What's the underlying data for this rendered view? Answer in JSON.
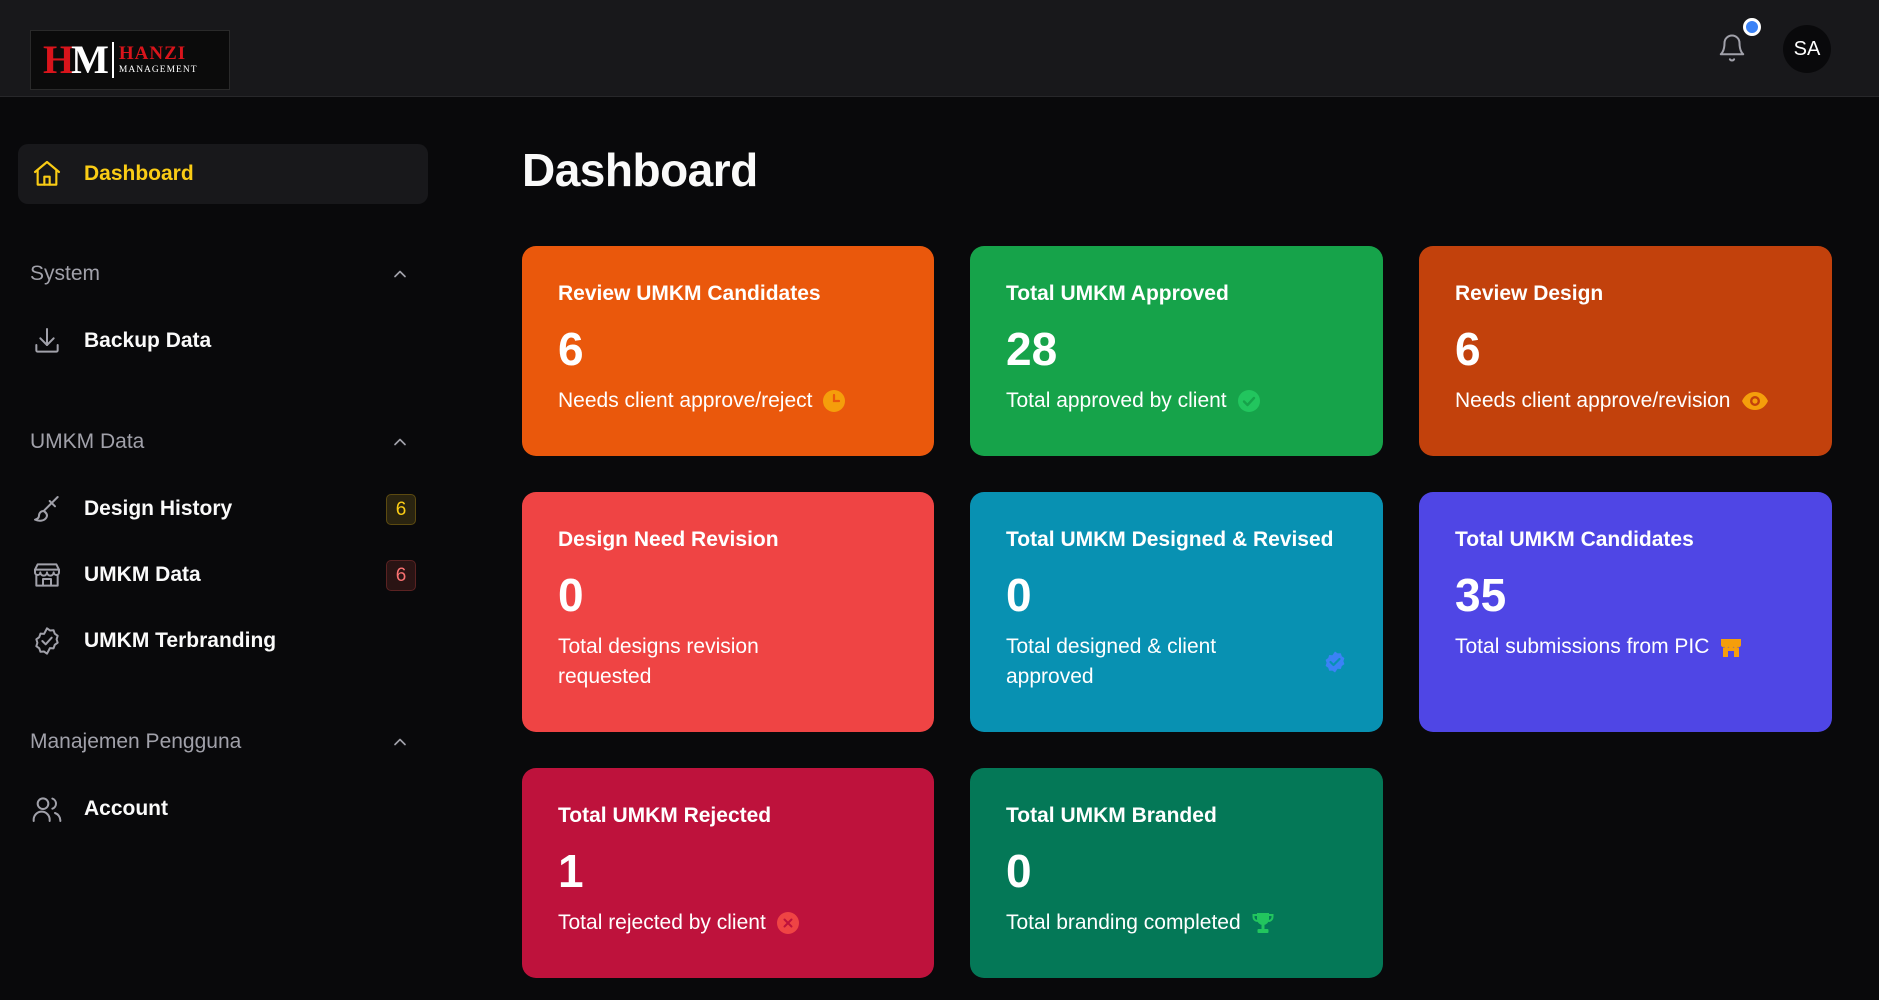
{
  "header": {
    "logo": {
      "mark_h": "H",
      "mark_m": "M",
      "brand": "HANZI",
      "sub": "MANAGEMENT"
    },
    "notification_icon": "bell-icon",
    "avatar_initials": "SA",
    "notification_dot_color": "#3b82f6"
  },
  "sidebar": {
    "active": {
      "label": "Dashboard",
      "icon": "home-icon"
    },
    "sections": [
      {
        "title": "System",
        "items": [
          {
            "label": "Backup Data",
            "icon": "download-icon"
          }
        ]
      },
      {
        "title": "UMKM Data",
        "items": [
          {
            "label": "Design History",
            "icon": "brush-icon",
            "badge": "6"
          },
          {
            "label": "UMKM Data",
            "icon": "store-icon",
            "badge": "6"
          },
          {
            "label": "UMKM Terbranding",
            "icon": "badge-check-icon"
          }
        ]
      },
      {
        "title": "Manajemen Pengguna",
        "items": [
          {
            "label": "Account",
            "icon": "users-icon"
          }
        ]
      }
    ]
  },
  "main": {
    "title": "Dashboard",
    "cards": [
      {
        "title": "Review UMKM Candidates",
        "value": "6",
        "desc": "Needs client approve/reject",
        "color": "#ea580c",
        "icon": "clock-icon"
      },
      {
        "title": "Total UMKM Approved",
        "value": "28",
        "desc": "Total approved by client",
        "color": "#16a34a",
        "icon": "check-circle-icon"
      },
      {
        "title": "Review Design",
        "value": "6",
        "desc": "Needs client approve/revision",
        "color": "#c2410c",
        "icon": "eye-icon"
      },
      {
        "title": "Design Need Revision",
        "value": "0",
        "desc": "Total designs revision requested",
        "color": "#ef4444"
      },
      {
        "title": "Total UMKM Designed & Revised",
        "value": "0",
        "desc": "Total designed & client approved",
        "color": "#0891b2",
        "icon": "verified-icon"
      },
      {
        "title": "Total UMKM Candidates",
        "value": "35",
        "desc": "Total submissions from PIC",
        "color": "#4f46e5",
        "icon": "store-icon"
      },
      {
        "title": "Total UMKM Rejected",
        "value": "1",
        "desc": "Total rejected by client",
        "color": "#be123c",
        "icon": "x-circle-icon"
      },
      {
        "title": "Total UMKM Branded",
        "value": "0",
        "desc": "Total branding completed",
        "color": "#047857",
        "icon": "trophy-icon"
      }
    ]
  }
}
